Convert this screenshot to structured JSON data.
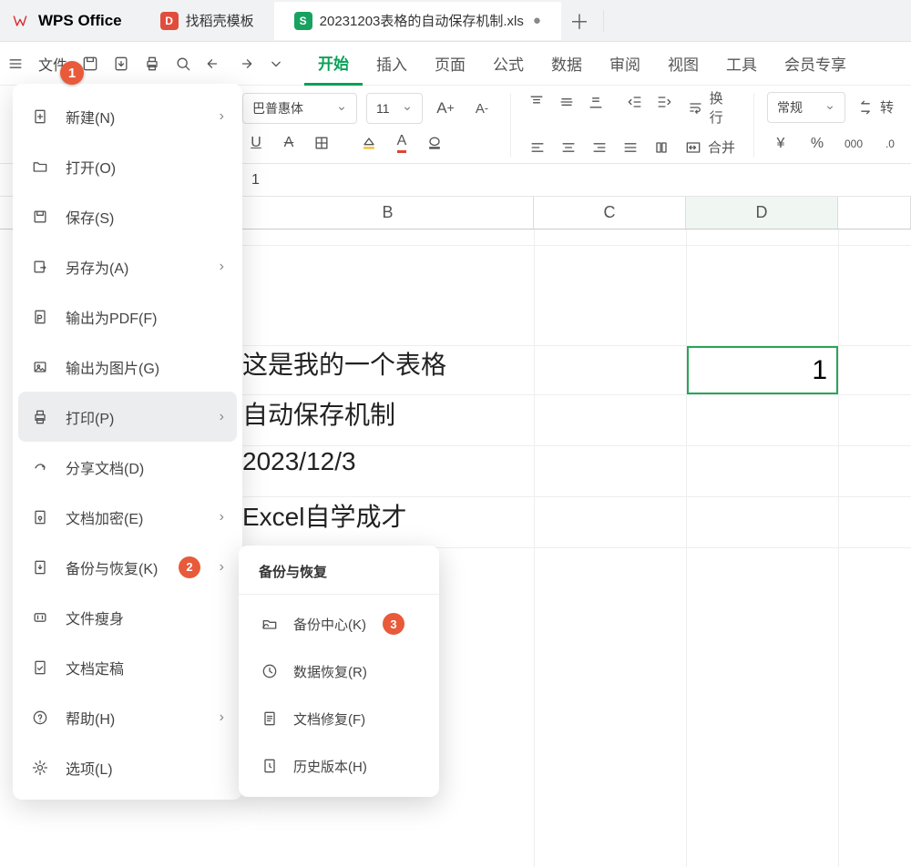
{
  "app": {
    "name": "WPS Office"
  },
  "tabs": [
    {
      "label": "找稻壳模板"
    },
    {
      "label": "20231203表格的自动保存机制.xls",
      "dirty": "●"
    }
  ],
  "file_button": "文件",
  "ribbon": [
    "开始",
    "插入",
    "页面",
    "公式",
    "数据",
    "审阅",
    "视图",
    "工具",
    "会员专享"
  ],
  "font": {
    "name": "巴普惠体",
    "size": "11"
  },
  "wrap_label": "换行",
  "merge_label": "合并",
  "numfmt_label": "常规",
  "rotate_label": "转",
  "formula_value": "1",
  "columns": {
    "B": "B",
    "C": "C",
    "D": "D"
  },
  "cells": {
    "row1": "这是我的一个表格",
    "row2": "自动保存机制",
    "row3": "2023/12/3",
    "row4": "Excel自学成才",
    "d_val": "1"
  },
  "menu": {
    "new": "新建(N)",
    "open": "打开(O)",
    "save": "保存(S)",
    "saveas": "另存为(A)",
    "pdf": "输出为PDF(F)",
    "img": "输出为图片(G)",
    "print": "打印(P)",
    "share": "分享文档(D)",
    "encrypt": "文档加密(E)",
    "backup": "备份与恢复(K)",
    "slim": "文件瘦身",
    "finalize": "文档定稿",
    "help": "帮助(H)",
    "options": "选项(L)"
  },
  "annotations": {
    "b1": "1",
    "b2": "2",
    "b3": "3"
  },
  "sub": {
    "title": "备份与恢复",
    "center": "备份中心(K)",
    "recover": "数据恢复(R)",
    "repair": "文档修复(F)",
    "history": "历史版本(H)"
  }
}
